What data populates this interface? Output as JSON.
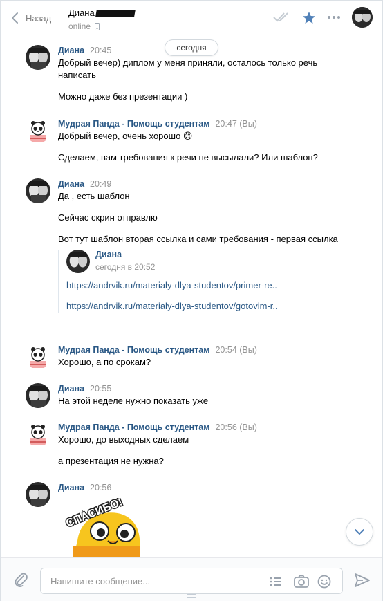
{
  "header": {
    "back_label": "Назад",
    "peer_name": "Диана",
    "peer_status": "online"
  },
  "date_separator": "сегодня",
  "messages": [
    {
      "author": "Диана",
      "time": "20:45",
      "texts": [
        "Добрый вечер) диплом у меня приняли, осталось только речь написать",
        "Можно даже без презентации )"
      ]
    },
    {
      "author": "Мудрая Панда - Помощь студентам",
      "time": "20:47 (Вы)",
      "texts": [
        "Добрый вечер, очень хорошо 😊",
        "Сделаем, вам требования к речи не высылали? Или шаблон?"
      ]
    },
    {
      "author": "Диана",
      "time": "20:49",
      "texts": [
        "Да , есть шаблон",
        "Сейчас скрин отправлю",
        "Вот тут шаблон вторая ссылка и сами требования - первая ссылка"
      ],
      "forwarded": {
        "author": "Диана",
        "time": "сегодня в 20:52",
        "links": [
          "https://andrvik.ru/materialy-dlya-studentov/primer-re..",
          "https://andrvik.ru/materialy-dlya-studentov/gotovim-r.."
        ]
      }
    },
    {
      "author": "Мудрая Панда - Помощь студентам",
      "time": "20:54 (Вы)",
      "texts": [
        "Хорошо, а по срокам?"
      ]
    },
    {
      "author": "Диана",
      "time": "20:55",
      "texts": [
        "На этой неделе нужно показать уже"
      ]
    },
    {
      "author": "Мудрая Панда - Помощь студентам",
      "time": "20:56 (Вы)",
      "texts": [
        "Хорошо, до выходных сделаем",
        "а презентация не нужна?"
      ]
    },
    {
      "author": "Диана",
      "time": "20:56",
      "sticker_text": "СПАСИБО!"
    }
  ],
  "composer": {
    "placeholder": "Напишите сообщение..."
  },
  "colors": {
    "link": "#2a5885",
    "accent": "#5181b8",
    "muted": "#939393"
  },
  "icons": [
    "chevron-left-icon",
    "double-check-icon",
    "star-icon",
    "more-icon",
    "phone-icon",
    "attach-icon",
    "list-icon",
    "camera-icon",
    "emoji-icon",
    "send-icon",
    "chevron-down-icon"
  ]
}
